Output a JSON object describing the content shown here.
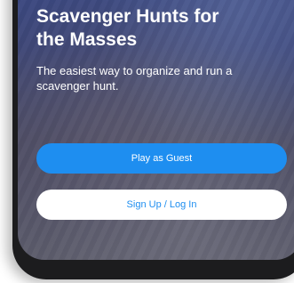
{
  "hero": {
    "headline": "Scavenger Hunts for the Masses",
    "tagline": "The easiest way to organize and run a scavenger hunt."
  },
  "actions": {
    "guest_label": "Play as Guest",
    "signup_label": "Sign Up / Log In"
  },
  "colors": {
    "accent": "#1e8ef0",
    "phone_frame": "#1c1c1e",
    "text": "#ffffff"
  }
}
